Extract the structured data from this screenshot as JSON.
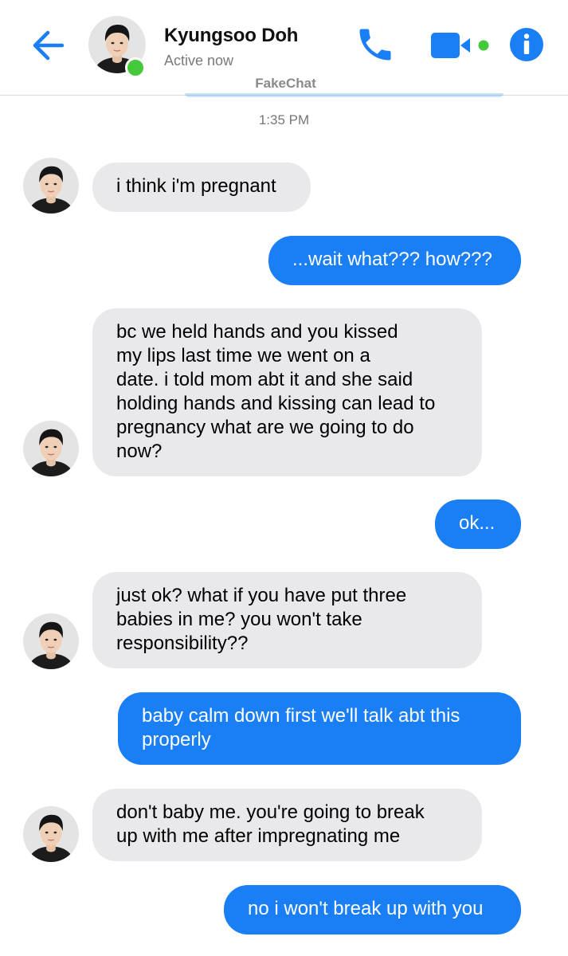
{
  "header": {
    "contact_name": "Kyungsoo Doh",
    "status": "Active now",
    "watermark": "FakeChat",
    "accent_color": "#1a7ff5",
    "online_color": "#44c93b",
    "icons": [
      "back-arrow-icon",
      "phone-icon",
      "video-camera-icon",
      "info-icon"
    ]
  },
  "conversation": {
    "timestamp": "1:35 PM",
    "messages": [
      {
        "from": "them",
        "text": "i think i'm pregnant"
      },
      {
        "from": "me",
        "text": "...wait what??? how???"
      },
      {
        "from": "them",
        "text": "bc we held hands and you kissed\nmy lips last time we went on a\ndate. i told mom abt it and she said\nholding hands and kissing can lead to\npregnancy what are we going to do\nnow?"
      },
      {
        "from": "me",
        "text": "ok..."
      },
      {
        "from": "them",
        "text": "just ok? what if you have put three\nbabies in me? you won't take\nresponsibility??"
      },
      {
        "from": "me",
        "text": "baby calm down first we'll talk abt this\nproperly"
      },
      {
        "from": "them",
        "text": "don't baby me.  you're going to break\nup with me after impregnating me"
      },
      {
        "from": "me",
        "text": "no i won't break up with you"
      }
    ]
  }
}
